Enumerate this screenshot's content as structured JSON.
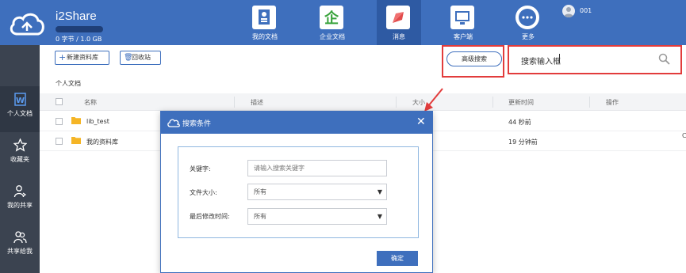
{
  "app": {
    "name": "i2Share",
    "quota": "0 字节 / 1.0 GB",
    "user": "001"
  },
  "nav": [
    {
      "label": "我的文档",
      "icon": "my-docs-icon",
      "color": "#3e6fbd"
    },
    {
      "label": "企业文档",
      "icon": "enterprise-docs-icon",
      "color": "#39a33c"
    },
    {
      "label": "消息",
      "icon": "message-rocket-icon",
      "color": "#e24b4b"
    },
    {
      "label": "客户端",
      "icon": "client-monitor-icon",
      "color": "#3e6fbd"
    },
    {
      "label": "更多",
      "icon": "more-icon",
      "color": "#3e6fbd"
    }
  ],
  "sidebar": [
    {
      "label": "个人文档",
      "icon": "personal-doc-icon"
    },
    {
      "label": "收藏夹",
      "icon": "star-icon"
    },
    {
      "label": "我的共享",
      "icon": "my-share-icon"
    },
    {
      "label": "共享给我",
      "icon": "shared-with-me-icon"
    }
  ],
  "toolbar": {
    "new_library": "新建资料库",
    "recycle_bin": "回收站",
    "advanced_search": "高级搜索"
  },
  "search": {
    "value": "搜索输入框"
  },
  "breadcrumb": "个人文档",
  "table": {
    "columns": [
      "名称",
      "描述",
      "大小",
      "更新时间",
      "操作"
    ],
    "rows": [
      {
        "name": "lib_test",
        "updated": "44 秒前"
      },
      {
        "name": "我的资料库",
        "updated": "19 分钟前"
      }
    ]
  },
  "dialog": {
    "title": "搜索条件",
    "keyword_label": "关键字:",
    "keyword_placeholder": "请输入搜索关键字",
    "size_label": "文件大小:",
    "size_value": "所有",
    "modified_label": "最后修改时间:",
    "modified_value": "所有",
    "ok": "确定"
  },
  "colors": {
    "primary": "#3e6fbd",
    "sidebar": "#3b4350",
    "highlight": "#e23c3c"
  }
}
